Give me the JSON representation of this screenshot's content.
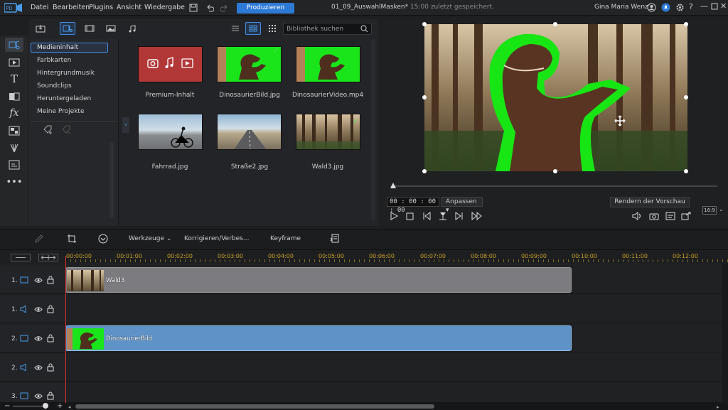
{
  "menu": {
    "items": [
      "Datei",
      "Bearbeiten",
      "Plugins",
      "Ansicht",
      "Wiedergabe"
    ],
    "produce_label": "Produzieren",
    "project_name": "01_09_AuswahlMasken*",
    "saved_status": "15:00 zuletzt gespeichert.",
    "user": "Gina Maria Wenz"
  },
  "library": {
    "search_placeholder": "Bibliothek suchen",
    "categories": [
      "Medieninhalt",
      "Farbkarten",
      "Hintergrundmusik",
      "Soundclips",
      "Heruntergeladen",
      "Meine Projekte"
    ],
    "media": [
      {
        "caption": "Premium-Inhalt",
        "checked": false
      },
      {
        "caption": "DinosaurierBild.jpg",
        "checked": true
      },
      {
        "caption": "DinosaurierVideo.mp4",
        "checked": false
      },
      {
        "caption": "Fahrrad.jpg",
        "checked": false
      },
      {
        "caption": "Straße2.jpg",
        "checked": false
      },
      {
        "caption": "Wald3.jpg",
        "checked": true
      }
    ]
  },
  "preview": {
    "timecode": "00 : 00 : 00 : 00",
    "fit_label": "Anpassen",
    "render_label": "Rendern der Vorschau",
    "aspect": "16:9"
  },
  "edit_toolbar": {
    "tools_label": "Werkzeuge",
    "fix_label": "Korrigieren/Verbes...",
    "keyframe_label": "Keyframe"
  },
  "timeline": {
    "ticks": [
      "00:00:00",
      "00:01:00",
      "00:02:00",
      "00:03:00",
      "00:04:00",
      "00:05:00",
      "00:06:00",
      "00:07:00",
      "00:08:00",
      "00:09:00",
      "00:10:00",
      "00:11:00",
      "00:12:00"
    ],
    "tracks": [
      {
        "num": "1.",
        "type": "video",
        "clip": "Wald3"
      },
      {
        "num": "1.",
        "type": "audio",
        "clip": ""
      },
      {
        "num": "2.",
        "type": "video",
        "clip": "DinosaurierBild"
      },
      {
        "num": "2.",
        "type": "audio",
        "clip": ""
      },
      {
        "num": "3.",
        "type": "video",
        "clip": ""
      }
    ]
  },
  "colors": {
    "accent": "#2d7ad6",
    "clip_wald": "#7c7c80",
    "clip_dino": "#5f93c7",
    "ruler_ticks": "#c9a227",
    "greenscreen": "#17e514"
  }
}
